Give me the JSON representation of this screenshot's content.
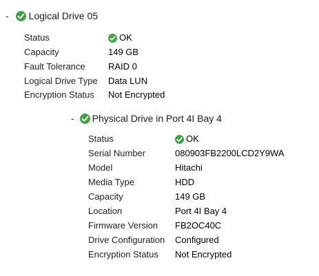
{
  "logical_drive": {
    "toggle": "-",
    "title": "Logical Drive 05",
    "properties": [
      {
        "label": "Status",
        "value": "OK",
        "status_icon": "ok-check-icon"
      },
      {
        "label": "Capacity",
        "value": "149 GB"
      },
      {
        "label": "Fault Tolerance",
        "value": "RAID 0"
      },
      {
        "label": "Logical Drive Type",
        "value": "Data LUN"
      },
      {
        "label": "Encryption Status",
        "value": "Not Encrypted"
      }
    ]
  },
  "physical_drive": {
    "toggle": "-",
    "title": "Physical Drive in Port 4I Bay 4",
    "properties": [
      {
        "label": "Status",
        "value": "OK",
        "status_icon": "ok-check-icon"
      },
      {
        "label": "Serial Number",
        "value": "080903FB2200LCD2Y9WA"
      },
      {
        "label": "Model",
        "value": "Hitachi"
      },
      {
        "label": "Media Type",
        "value": "HDD"
      },
      {
        "label": "Capacity",
        "value": "149 GB"
      },
      {
        "label": "Location",
        "value": "Port 4I Bay 4"
      },
      {
        "label": "Firmware Version",
        "value": "FB2OC40C"
      },
      {
        "label": "Drive Configuration",
        "value": "Configured"
      },
      {
        "label": "Encryption Status",
        "value": "Not Encrypted"
      }
    ]
  },
  "colors": {
    "ok_green": "#43a047",
    "text": "#1a1a1a",
    "background": "#ffffff"
  }
}
